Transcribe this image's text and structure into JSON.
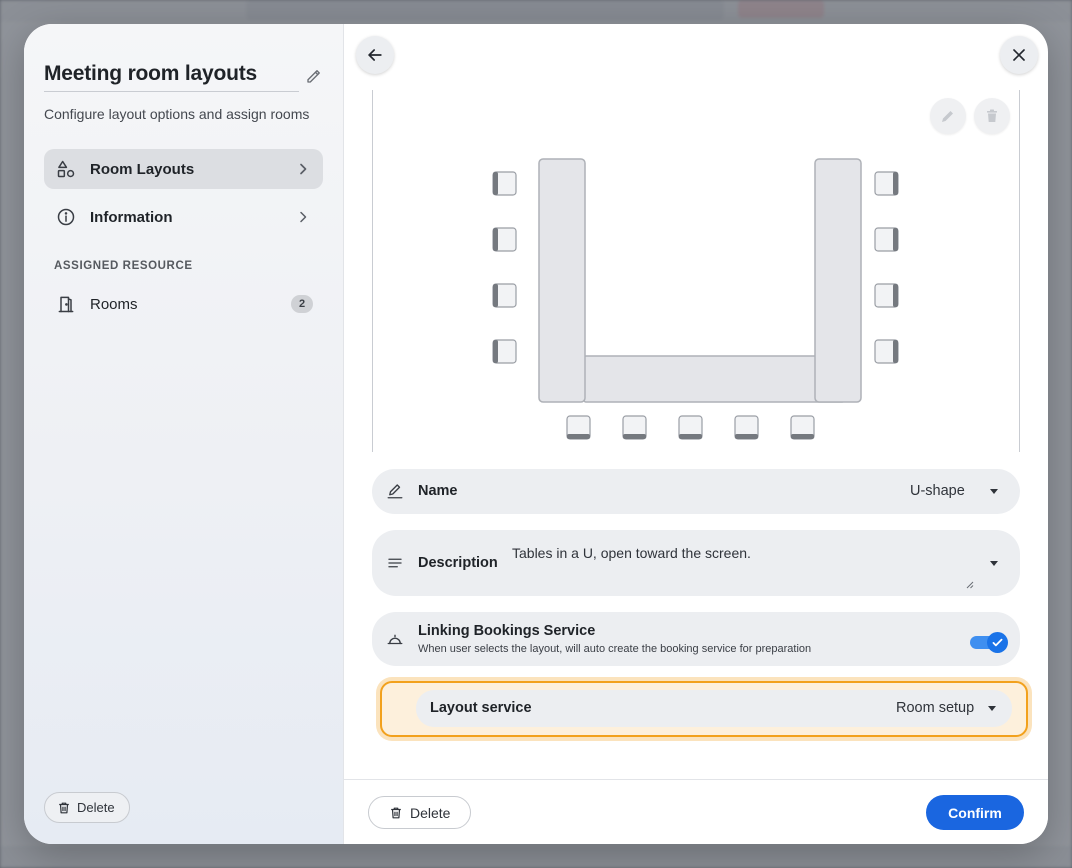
{
  "sidebar": {
    "title": "Meeting room layouts",
    "subtitle": "Configure layout options and assign rooms",
    "items": [
      {
        "label": "Room Layouts",
        "icon": "shapes-icon",
        "active": true
      },
      {
        "label": "Information",
        "icon": "info-icon",
        "active": false
      }
    ],
    "section_label": "ASSIGNED RESOURCE",
    "resources": [
      {
        "label": "Rooms",
        "icon": "door-icon",
        "count": "2"
      }
    ],
    "delete_label": "Delete"
  },
  "layout_form": {
    "name": {
      "label": "Name",
      "value": "U-shape",
      "icon": "pen-line-icon"
    },
    "description": {
      "label": "Description",
      "value": "Tables in a U, open toward the screen.",
      "icon": "lines-icon"
    },
    "linking": {
      "title": "Linking Bookings Service",
      "description": "When user selects the layout, will auto create the booking service for preparation",
      "enabled": true,
      "icon": "service-bell-icon"
    },
    "layout_service": {
      "label": "Layout service",
      "value": "Room setup"
    }
  },
  "footer": {
    "delete_label": "Delete",
    "confirm_label": "Confirm"
  },
  "colors": {
    "primary": "#1a66e0",
    "highlight_border": "#f2a11d",
    "field_bg": "#eceef1"
  }
}
